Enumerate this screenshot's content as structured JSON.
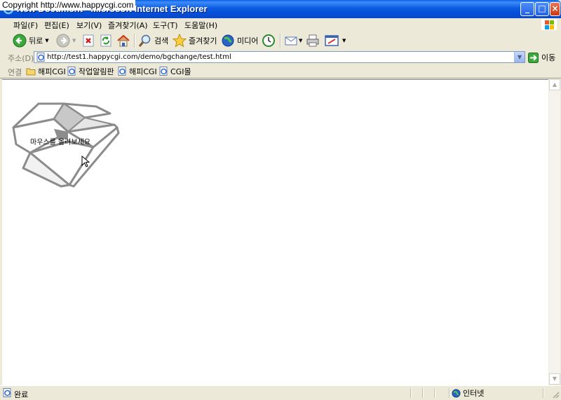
{
  "window": {
    "title": "New Document - Microsoft Internet Explorer",
    "minimize_label": "_",
    "maximize_label": "□",
    "close_label": "×"
  },
  "watermark": "Copyright  http://www.happycgi.com",
  "menu": [
    {
      "label": "파일(F)"
    },
    {
      "label": "편집(E)"
    },
    {
      "label": "보기(V)"
    },
    {
      "label": "즐겨찾기(A)"
    },
    {
      "label": "도구(T)"
    },
    {
      "label": "도움말(H)"
    }
  ],
  "toolbar": {
    "back_label": "뒤로",
    "search_label": "검색",
    "favorites_label": "즐겨찾기",
    "media_label": "미디어"
  },
  "address": {
    "label": "주소(D)",
    "url": "http://test1.happycgi.com/demo/bgchange/test.html",
    "go_label": "이동"
  },
  "links": {
    "label": "연결",
    "items": [
      {
        "label": "해피CGI",
        "icon": "folder-icon"
      },
      {
        "label": "작업알림판",
        "icon": "ie-page-icon"
      },
      {
        "label": "해피CGI",
        "icon": "ie-page-icon"
      },
      {
        "label": "CGI몰",
        "icon": "ie-page-icon"
      }
    ]
  },
  "page": {
    "hover_text": "마우스를 올려보세요"
  },
  "status": {
    "text": "완료",
    "zone": "인터넷"
  },
  "colors": {
    "titlebar": "#0a5fe6",
    "chrome": "#ece9d8",
    "content_bg": "#ffffff",
    "box_stroke": "#8c8c8c",
    "box_fill": "#d4d4d4"
  }
}
